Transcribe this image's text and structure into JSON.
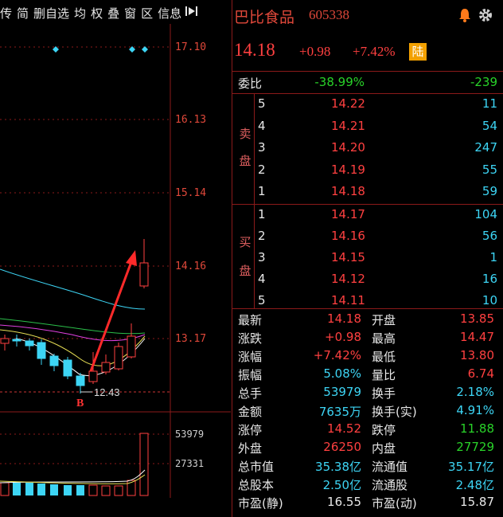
{
  "toolbar": [
    "传",
    "简",
    "删自选",
    "均",
    "权",
    "叠",
    "窗",
    "区",
    "信息"
  ],
  "stock": {
    "name": "巴比食品",
    "code": "605338",
    "price": "14.18",
    "change": "+0.98",
    "pct": "+7.42%",
    "badge": "陆"
  },
  "chart": {
    "y_ticks": [
      "17.10",
      "16.13",
      "15.14",
      "14.16",
      "13.17"
    ],
    "low_label": "12.43",
    "marker": "B",
    "vol_ticks": [
      "53979",
      "27331"
    ]
  },
  "weibi": {
    "label": "委比",
    "pct": "-38.99%",
    "diff": "-239"
  },
  "sell_label": [
    "卖",
    "盘"
  ],
  "buy_label": [
    "买",
    "盘"
  ],
  "sell": [
    {
      "lvl": "5",
      "price": "14.22",
      "vol": "11"
    },
    {
      "lvl": "4",
      "price": "14.21",
      "vol": "54"
    },
    {
      "lvl": "3",
      "price": "14.20",
      "vol": "247"
    },
    {
      "lvl": "2",
      "price": "14.19",
      "vol": "55"
    },
    {
      "lvl": "1",
      "price": "14.18",
      "vol": "59"
    }
  ],
  "buy": [
    {
      "lvl": "1",
      "price": "14.17",
      "vol": "104"
    },
    {
      "lvl": "2",
      "price": "14.16",
      "vol": "56"
    },
    {
      "lvl": "3",
      "price": "14.15",
      "vol": "1"
    },
    {
      "lvl": "4",
      "price": "14.12",
      "vol": "16"
    },
    {
      "lvl": "5",
      "price": "14.11",
      "vol": "10"
    }
  ],
  "stats": [
    {
      "l": "最新",
      "lv": "14.18",
      "r": "开盘",
      "rv": "13.85"
    },
    {
      "l": "涨跌",
      "lv": "+0.98",
      "r": "最高",
      "rv": "14.47"
    },
    {
      "l": "涨幅",
      "lv": "+7.42%",
      "r": "最低",
      "rv": "13.80"
    },
    {
      "l": "振幅",
      "lv": "5.08%",
      "r": "量比",
      "rv": "6.74"
    },
    {
      "l": "总手",
      "lv": "53979",
      "r": "换手",
      "rv": "2.18%"
    },
    {
      "l": "金额",
      "lv": "7635万",
      "r": "换手(实)",
      "rv": "4.91%"
    },
    {
      "l": "涨停",
      "lv": "14.52",
      "r": "跌停",
      "rv": "11.88"
    },
    {
      "l": "外盘",
      "lv": "26250",
      "r": "内盘",
      "rv": "27729"
    },
    {
      "l": "总市值",
      "lv": "35.38亿",
      "r": "流通值",
      "rv": "35.17亿"
    },
    {
      "l": "总股本",
      "lv": "2.50亿",
      "r": "流通股",
      "rv": "2.48亿"
    },
    {
      "l": "市盈(静)",
      "lv": "16.55",
      "r": "市盈(动)",
      "rv": "15.87"
    }
  ],
  "colors": {
    "up": "#ff4040",
    "down": "#3dd5f5",
    "grid": "#8b1a1a"
  }
}
